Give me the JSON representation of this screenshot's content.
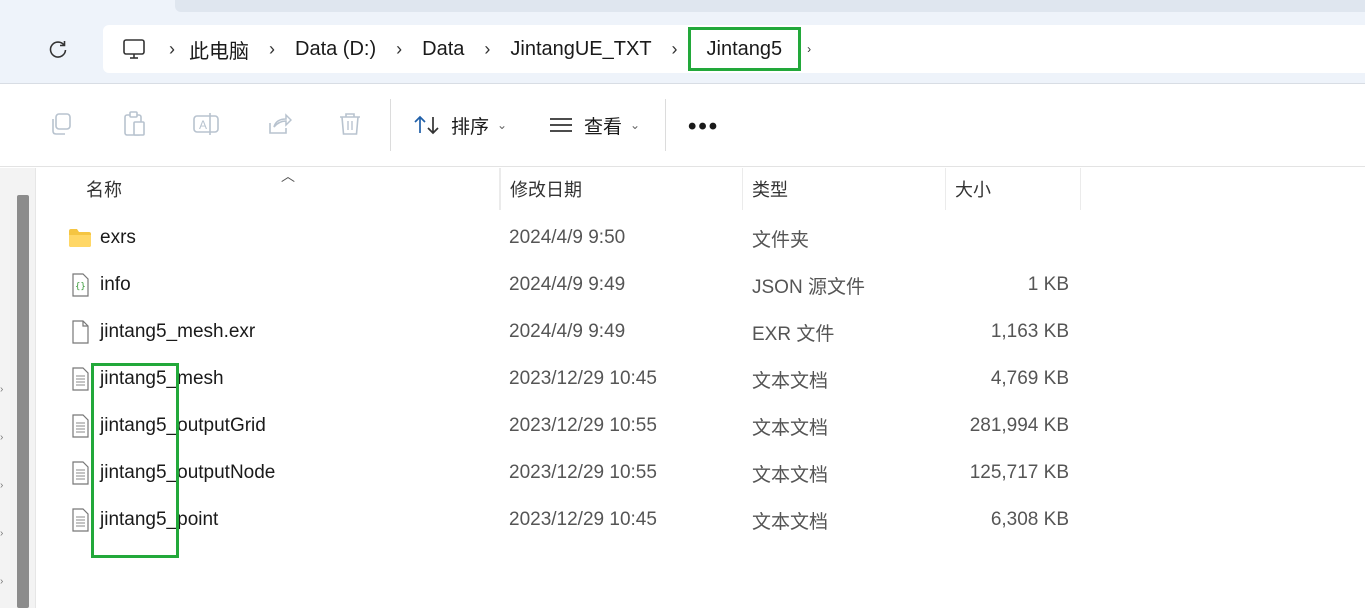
{
  "breadcrumb": {
    "items": [
      "此电脑",
      "Data (D:)",
      "Data",
      "JintangUE_TXT"
    ],
    "current": "Jintang5"
  },
  "toolbar": {
    "sort_label": "排序",
    "view_label": "查看",
    "more_label": "•••"
  },
  "columns": {
    "name": "名称",
    "date": "修改日期",
    "type": "类型",
    "size": "大小"
  },
  "files": [
    {
      "icon": "folder-icon",
      "name": "exrs",
      "date": "2024/4/9 9:50",
      "type": "文件夹",
      "size": ""
    },
    {
      "icon": "json-file-icon",
      "name": "info",
      "date": "2024/4/9 9:49",
      "type": "JSON 源文件",
      "size": "1 KB"
    },
    {
      "icon": "blank-file-icon",
      "name": "jintang5_mesh.exr",
      "date": "2024/4/9 9:49",
      "type": "EXR 文件",
      "size": "1,163 KB"
    },
    {
      "icon": "text-file-icon",
      "name": "jintang5_mesh",
      "date": "2023/12/29 10:45",
      "type": "文本文档",
      "size": "4,769 KB"
    },
    {
      "icon": "text-file-icon",
      "name": "jintang5_outputGrid",
      "date": "2023/12/29 10:55",
      "type": "文本文档",
      "size": "281,994 KB"
    },
    {
      "icon": "text-file-icon",
      "name": "jintang5_outputNode",
      "date": "2023/12/29 10:55",
      "type": "文本文档",
      "size": "125,717 KB"
    },
    {
      "icon": "text-file-icon",
      "name": "jintang5_point",
      "date": "2023/12/29 10:45",
      "type": "文本文档",
      "size": "6,308 KB"
    }
  ],
  "colors": {
    "highlight": "#22a83a",
    "folder": "#f5c542"
  }
}
